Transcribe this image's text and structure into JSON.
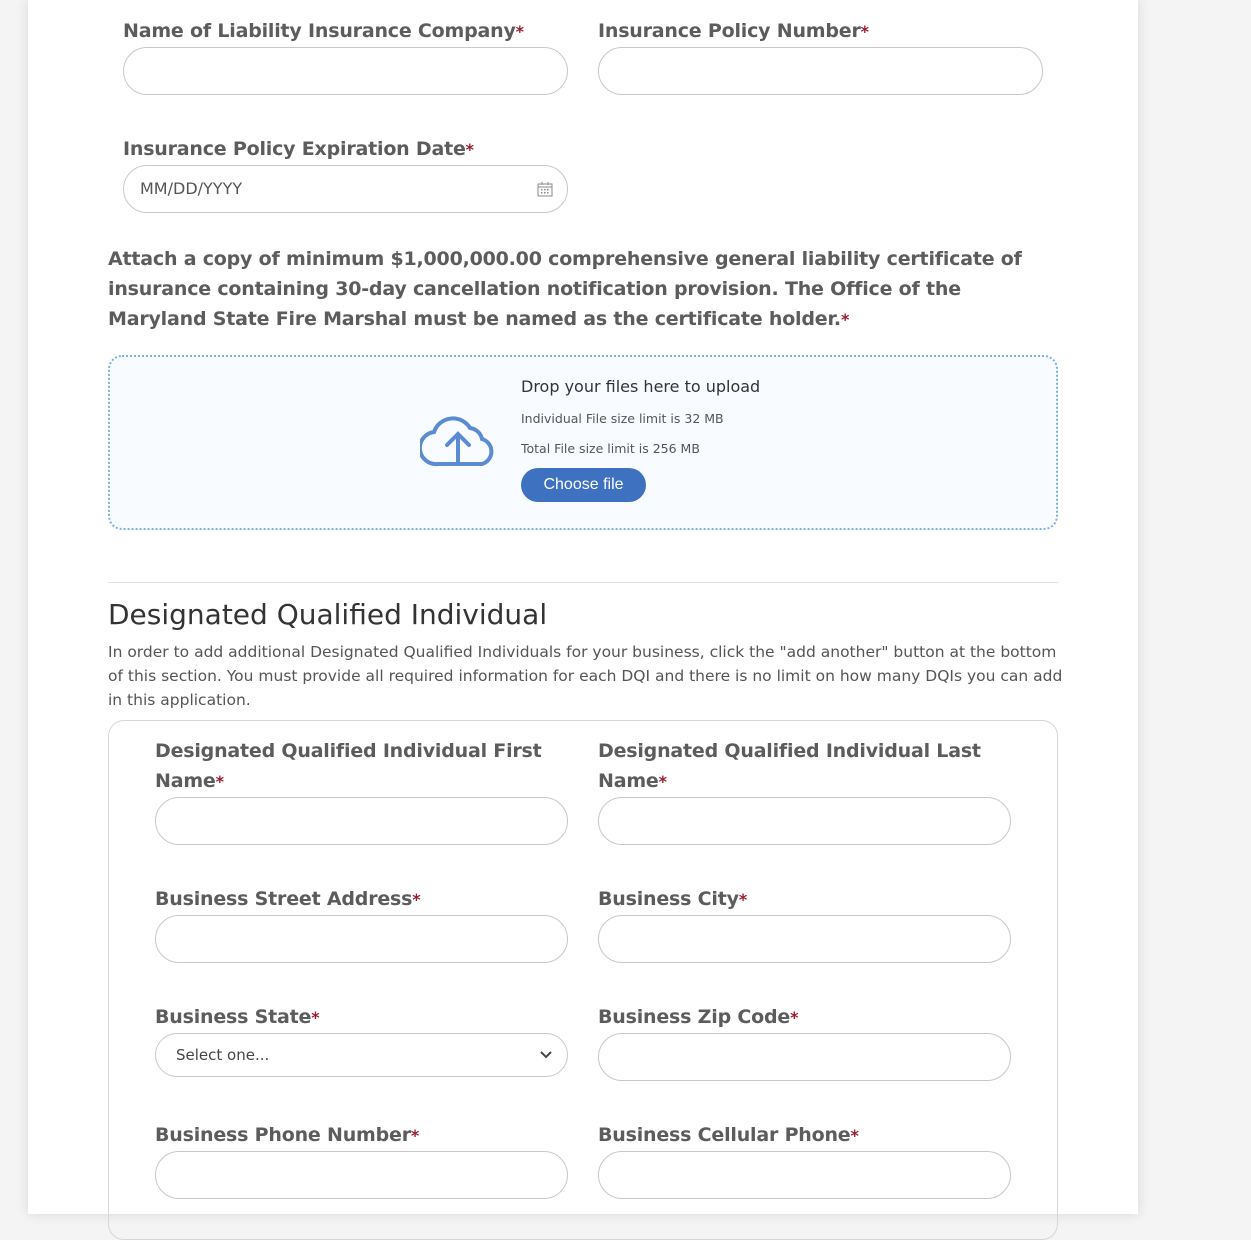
{
  "insurance": {
    "company_label": "Name of Liability Insurance Company",
    "policy_label": "Insurance Policy Number",
    "expiration_label": "Insurance Policy Expiration Date",
    "expiration_placeholder": "MM/DD/YYYY",
    "required_mark": "*"
  },
  "attachment": {
    "text": "Attach a copy of minimum $1,000,000.00 comprehensive general liability certificate of insurance containing 30-day cancellation notification provision. The Office of the Maryland State Fire Marshal must be named as the certificate holder.",
    "drop_title": "Drop your files here to upload",
    "individual_limit": "Individual File size limit is 32 MB",
    "total_limit": "Total File size limit is 256 MB",
    "choose_label": "Choose file",
    "accent": "#3f71c1"
  },
  "dqi": {
    "title": "Designated Qualified Individual",
    "description": "In order to add additional Designated Qualified Individuals for your business, click the \"add another\" button at the bottom of this section. You must provide all required information for each DQI and there is no limit on how many DQIs you can add in this application.",
    "first_name_label": "Designated Qualified Individual First Name",
    "last_name_label": "Designated Qualified Individual Last Name",
    "street_label": "Business Street Address",
    "city_label": "Business City",
    "state_label": "Business State",
    "state_value": "Select one...",
    "zip_label": "Business Zip Code",
    "phone_label": "Business Phone Number",
    "cell_label": "Business Cellular Phone"
  }
}
